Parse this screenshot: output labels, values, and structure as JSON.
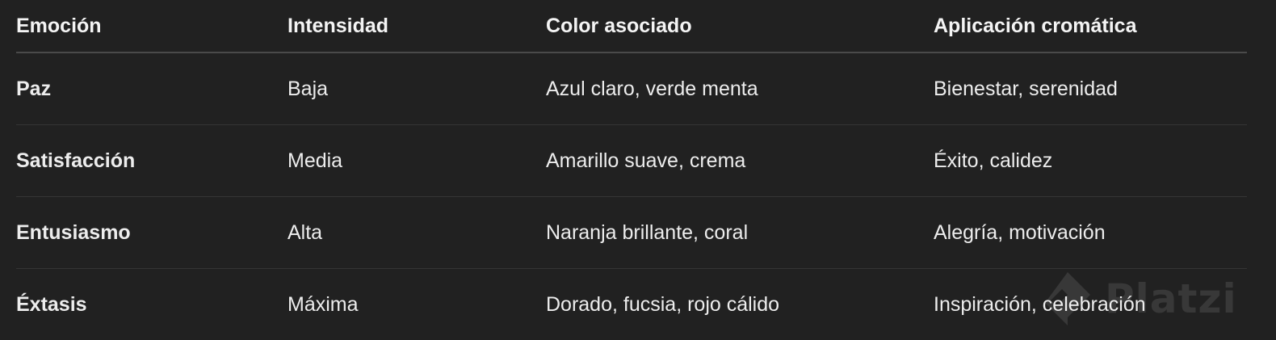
{
  "table": {
    "headers": [
      "Emoción",
      "Intensidad",
      "Color asociado",
      "Aplicación cromática"
    ],
    "rows": [
      [
        "Paz",
        "Baja",
        "Azul claro, verde menta",
        "Bienestar, serenidad"
      ],
      [
        "Satisfacción",
        "Media",
        "Amarillo suave, crema",
        "Éxito, calidez"
      ],
      [
        "Entusiasmo",
        "Alta",
        "Naranja brillante, coral",
        "Alegría, motivación"
      ],
      [
        "Éxtasis",
        "Máxima",
        "Dorado, fucsia, rojo cálido",
        "Inspiración, celebración"
      ]
    ]
  },
  "watermark": {
    "text": "Platzi",
    "icon": "platzi-logo-icon"
  },
  "colors": {
    "background": "#212121",
    "text": "#f2f2f2",
    "header_rule": "#4a4a4a",
    "row_rule": "#353535"
  }
}
